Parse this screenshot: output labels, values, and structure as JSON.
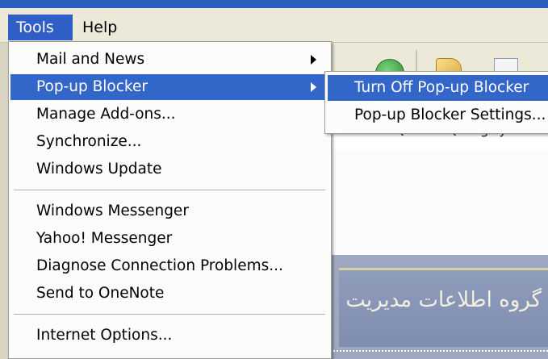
{
  "menubar": {
    "tools": "Tools",
    "help": "Help"
  },
  "tools_menu": {
    "items": [
      {
        "label": "Mail and News"
      },
      {
        "label": "Pop-up Blocker"
      },
      {
        "label": "Manage Add-ons..."
      },
      {
        "label": "Synchronize..."
      },
      {
        "label": "Windows Update"
      },
      {
        "label": "Windows Messenger"
      },
      {
        "label": "Yahoo! Messenger"
      },
      {
        "label": "Diagnose Connection Problems..."
      },
      {
        "label": "Send to OneNote"
      },
      {
        "label": "Internet Options..."
      }
    ]
  },
  "popup_submenu": {
    "items": [
      {
        "label": "Turn Off Pop-up Blocker"
      },
      {
        "label": "Pop-up Blocker Settings..."
      }
    ]
  },
  "background": {
    "address_text": "o=BcmRQs6ThSQEmgNyCv",
    "banner_text": "گروه اطلاعات مدیریت"
  },
  "colors": {
    "highlight": "#3266c8",
    "menubar": "#ece9d8",
    "titlebar": "#2b5fbf"
  }
}
